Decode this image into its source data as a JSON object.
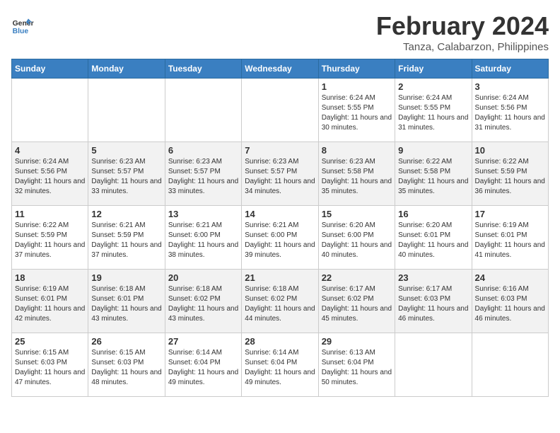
{
  "app": {
    "name": "GeneralBlue",
    "title": "February 2024",
    "subtitle": "Tanza, Calabarzon, Philippines"
  },
  "calendar": {
    "headers": [
      "Sunday",
      "Monday",
      "Tuesday",
      "Wednesday",
      "Thursday",
      "Friday",
      "Saturday"
    ],
    "weeks": [
      [
        {
          "day": "",
          "info": ""
        },
        {
          "day": "",
          "info": ""
        },
        {
          "day": "",
          "info": ""
        },
        {
          "day": "",
          "info": ""
        },
        {
          "day": "1",
          "info": "Sunrise: 6:24 AM\nSunset: 5:55 PM\nDaylight: 11 hours and 30 minutes."
        },
        {
          "day": "2",
          "info": "Sunrise: 6:24 AM\nSunset: 5:55 PM\nDaylight: 11 hours and 31 minutes."
        },
        {
          "day": "3",
          "info": "Sunrise: 6:24 AM\nSunset: 5:56 PM\nDaylight: 11 hours and 31 minutes."
        }
      ],
      [
        {
          "day": "4",
          "info": "Sunrise: 6:24 AM\nSunset: 5:56 PM\nDaylight: 11 hours and 32 minutes."
        },
        {
          "day": "5",
          "info": "Sunrise: 6:23 AM\nSunset: 5:57 PM\nDaylight: 11 hours and 33 minutes."
        },
        {
          "day": "6",
          "info": "Sunrise: 6:23 AM\nSunset: 5:57 PM\nDaylight: 11 hours and 33 minutes."
        },
        {
          "day": "7",
          "info": "Sunrise: 6:23 AM\nSunset: 5:57 PM\nDaylight: 11 hours and 34 minutes."
        },
        {
          "day": "8",
          "info": "Sunrise: 6:23 AM\nSunset: 5:58 PM\nDaylight: 11 hours and 35 minutes."
        },
        {
          "day": "9",
          "info": "Sunrise: 6:22 AM\nSunset: 5:58 PM\nDaylight: 11 hours and 35 minutes."
        },
        {
          "day": "10",
          "info": "Sunrise: 6:22 AM\nSunset: 5:59 PM\nDaylight: 11 hours and 36 minutes."
        }
      ],
      [
        {
          "day": "11",
          "info": "Sunrise: 6:22 AM\nSunset: 5:59 PM\nDaylight: 11 hours and 37 minutes."
        },
        {
          "day": "12",
          "info": "Sunrise: 6:21 AM\nSunset: 5:59 PM\nDaylight: 11 hours and 37 minutes."
        },
        {
          "day": "13",
          "info": "Sunrise: 6:21 AM\nSunset: 6:00 PM\nDaylight: 11 hours and 38 minutes."
        },
        {
          "day": "14",
          "info": "Sunrise: 6:21 AM\nSunset: 6:00 PM\nDaylight: 11 hours and 39 minutes."
        },
        {
          "day": "15",
          "info": "Sunrise: 6:20 AM\nSunset: 6:00 PM\nDaylight: 11 hours and 40 minutes."
        },
        {
          "day": "16",
          "info": "Sunrise: 6:20 AM\nSunset: 6:01 PM\nDaylight: 11 hours and 40 minutes."
        },
        {
          "day": "17",
          "info": "Sunrise: 6:19 AM\nSunset: 6:01 PM\nDaylight: 11 hours and 41 minutes."
        }
      ],
      [
        {
          "day": "18",
          "info": "Sunrise: 6:19 AM\nSunset: 6:01 PM\nDaylight: 11 hours and 42 minutes."
        },
        {
          "day": "19",
          "info": "Sunrise: 6:18 AM\nSunset: 6:01 PM\nDaylight: 11 hours and 43 minutes."
        },
        {
          "day": "20",
          "info": "Sunrise: 6:18 AM\nSunset: 6:02 PM\nDaylight: 11 hours and 43 minutes."
        },
        {
          "day": "21",
          "info": "Sunrise: 6:18 AM\nSunset: 6:02 PM\nDaylight: 11 hours and 44 minutes."
        },
        {
          "day": "22",
          "info": "Sunrise: 6:17 AM\nSunset: 6:02 PM\nDaylight: 11 hours and 45 minutes."
        },
        {
          "day": "23",
          "info": "Sunrise: 6:17 AM\nSunset: 6:03 PM\nDaylight: 11 hours and 46 minutes."
        },
        {
          "day": "24",
          "info": "Sunrise: 6:16 AM\nSunset: 6:03 PM\nDaylight: 11 hours and 46 minutes."
        }
      ],
      [
        {
          "day": "25",
          "info": "Sunrise: 6:15 AM\nSunset: 6:03 PM\nDaylight: 11 hours and 47 minutes."
        },
        {
          "day": "26",
          "info": "Sunrise: 6:15 AM\nSunset: 6:03 PM\nDaylight: 11 hours and 48 minutes."
        },
        {
          "day": "27",
          "info": "Sunrise: 6:14 AM\nSunset: 6:04 PM\nDaylight: 11 hours and 49 minutes."
        },
        {
          "day": "28",
          "info": "Sunrise: 6:14 AM\nSunset: 6:04 PM\nDaylight: 11 hours and 49 minutes."
        },
        {
          "day": "29",
          "info": "Sunrise: 6:13 AM\nSunset: 6:04 PM\nDaylight: 11 hours and 50 minutes."
        },
        {
          "day": "",
          "info": ""
        },
        {
          "day": "",
          "info": ""
        }
      ]
    ]
  }
}
